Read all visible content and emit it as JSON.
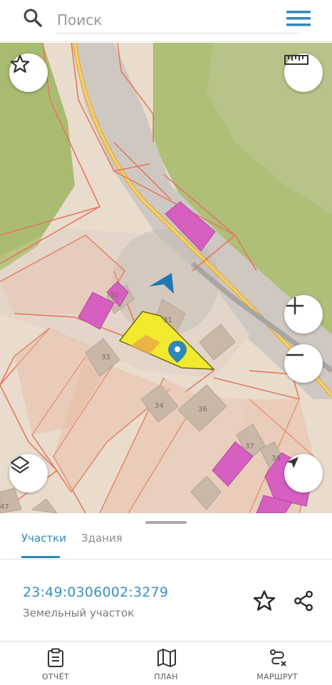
{
  "search": {
    "placeholder": "Поиск"
  },
  "map": {
    "parcel_labels": [
      "30",
      "31",
      "33",
      "34",
      "36",
      "37",
      "38",
      "47"
    ]
  },
  "tabs": {
    "active": "Участки",
    "inactive": "Здания"
  },
  "parcel": {
    "cadastral_number": "23:49:0306002:3279",
    "type": "Земельный участок"
  },
  "nav": {
    "report": "ОТЧЁТ",
    "plan": "ПЛАН",
    "route": "МАРШРУТ"
  },
  "colors": {
    "accent": "#2f87b8",
    "parcel_border": "#e8735a",
    "building_magenta": "#d65fc0",
    "selected_parcel": "#f2ea2e"
  }
}
